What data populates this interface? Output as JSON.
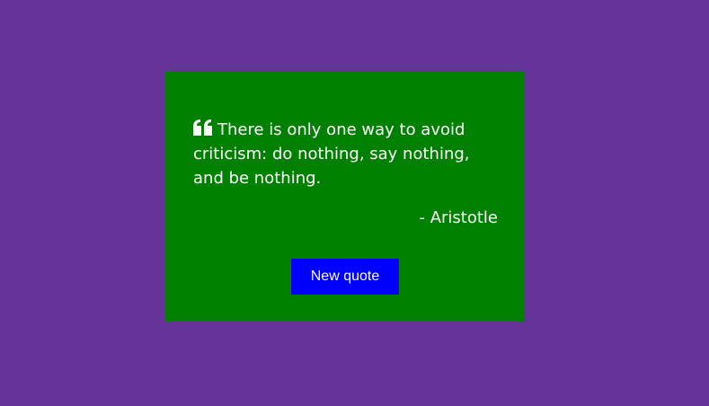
{
  "quote": {
    "text": "There is only one way to avoid criticism: do nothing, say nothing, and be nothing.",
    "author": "- Aristotle",
    "icon": "quote-left-icon"
  },
  "button": {
    "new_quote_label": "New quote"
  },
  "colors": {
    "background": "#663399",
    "card": "#008000",
    "button": "#0000ff",
    "text": "#ffffff"
  }
}
